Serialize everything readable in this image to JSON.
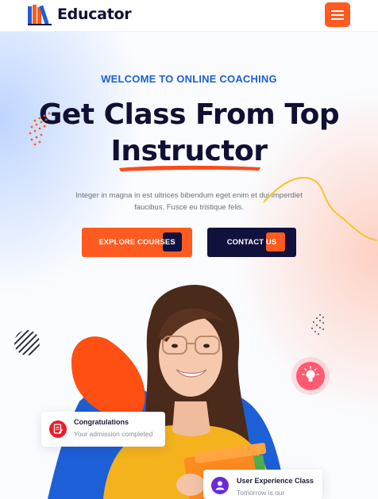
{
  "header": {
    "logo_text": "Educator",
    "menu_icon": "hamburger-menu-icon"
  },
  "hero": {
    "eyebrow": "WELCOME TO ONLINE COACHING",
    "headline_line1": "Get Class From Top",
    "headline_line2": "Instructor",
    "description": "Integer in magna in est ultrices bibendum eget enim et dui imperdiet faucibus. Fusce eu tristique felis.",
    "explore_button": "EXPLORE COURSES",
    "contact_button": "CONTACT US"
  },
  "cards": {
    "admission_title": "Congratulations",
    "admission_text": "Your admission completed",
    "class_title": "User Experience Class",
    "class_text": "Tomorrow is our"
  },
  "colors": {
    "accent": "#ff5a1f",
    "navy": "#10113d",
    "blue": "#1d5fd6",
    "pink": "#ff5a72"
  },
  "icons": [
    "books-logo-icon",
    "hamburger-menu-icon",
    "lightbulb-icon",
    "document-icon",
    "user-icon"
  ]
}
